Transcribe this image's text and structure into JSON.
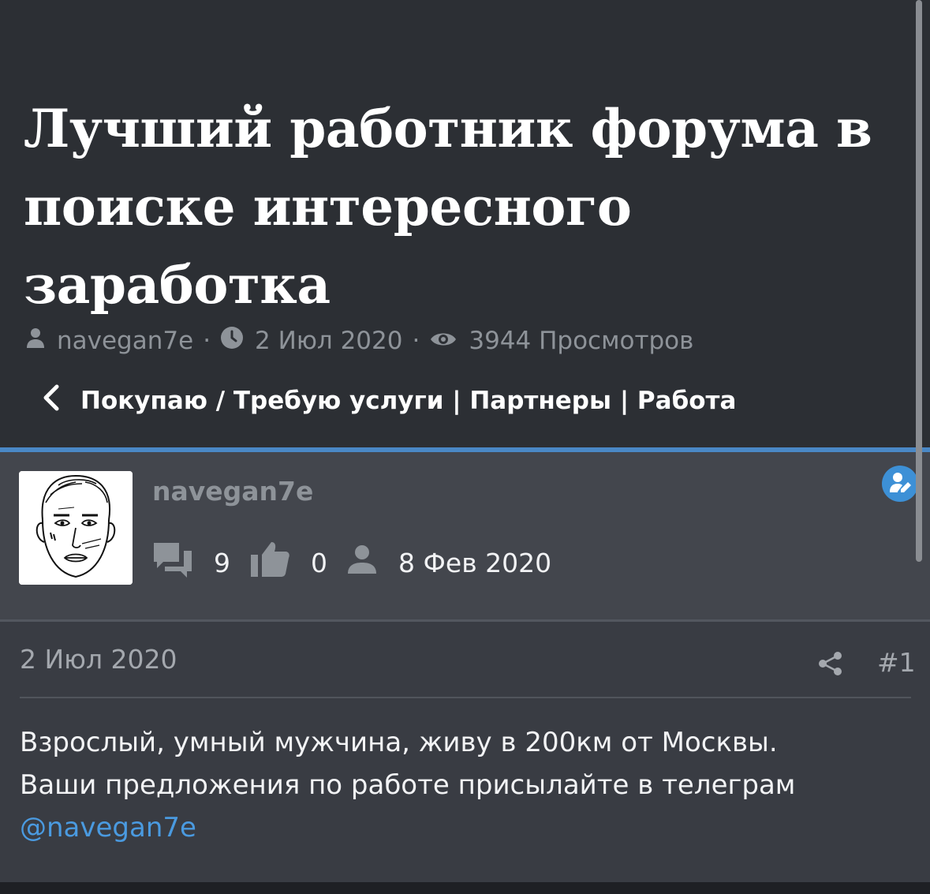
{
  "thread": {
    "title": "Лучший работник форума в поиске интересного заработка",
    "author": "navegan7e",
    "date": "2 Июл 2020",
    "views": "3944 Просмотров",
    "separator": "·"
  },
  "breadcrumb": {
    "label": "Покупаю / Требую услуги | Партнеры | Работа"
  },
  "user": {
    "name": "navegan7e",
    "messages": "9",
    "likes": "0",
    "joined": "8 Фев 2020"
  },
  "post": {
    "date": "2 Июл 2020",
    "number": "#1",
    "line1": "Взрослый, умный мужчина, живу в 200км от Москвы.",
    "line2": "Ваши предложения по работе присылайте в телеграм",
    "mention": "@navegan7e"
  },
  "colors": {
    "background": "#2c2f34",
    "accent": "#4a88c6",
    "link": "#4a9ae0",
    "muted_text": "#8e9399"
  },
  "icons": [
    "user-icon",
    "clock-icon",
    "eye-icon",
    "chevron-left-icon",
    "messages-icon",
    "thumbs-up-icon",
    "edit-icon",
    "share-icon"
  ]
}
